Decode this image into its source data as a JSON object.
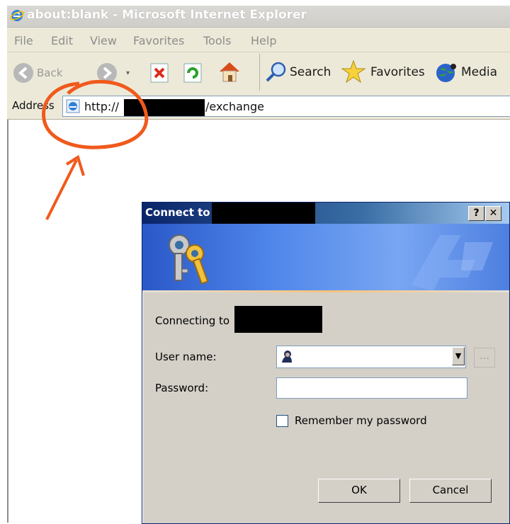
{
  "window": {
    "title": "about:blank - Microsoft Internet Explorer"
  },
  "menu": [
    "File",
    "Edit",
    "View",
    "Favorites",
    "Tools",
    "Help"
  ],
  "toolbar": {
    "back_label": "Back",
    "search_label": "Search",
    "favorites_label": "Favorites",
    "media_label": "Media",
    "icons": [
      "back-arrow-icon",
      "forward-arrow-icon",
      "stop-icon",
      "refresh-icon",
      "home-icon",
      "search-magnifier-icon",
      "favorites-star-icon",
      "media-globe-icon"
    ]
  },
  "address": {
    "label": "Address",
    "url_prefix": "http://",
    "url_suffix": "/exchange"
  },
  "dialog": {
    "title": "Connect to",
    "help_button": "?",
    "close_button": "✕",
    "connecting_text": "Connecting to",
    "username_label": "User name:",
    "password_label": "Password:",
    "remember_label": "Remember my password",
    "remember_checked": false,
    "ok_label": "OK",
    "cancel_label": "Cancel",
    "banner_icon": "keys-icon",
    "username_icon": "user-icon"
  },
  "colors": {
    "annotation": "#f05a1c",
    "dialog_title": "#0a246a",
    "banner": "#4f86ea"
  }
}
